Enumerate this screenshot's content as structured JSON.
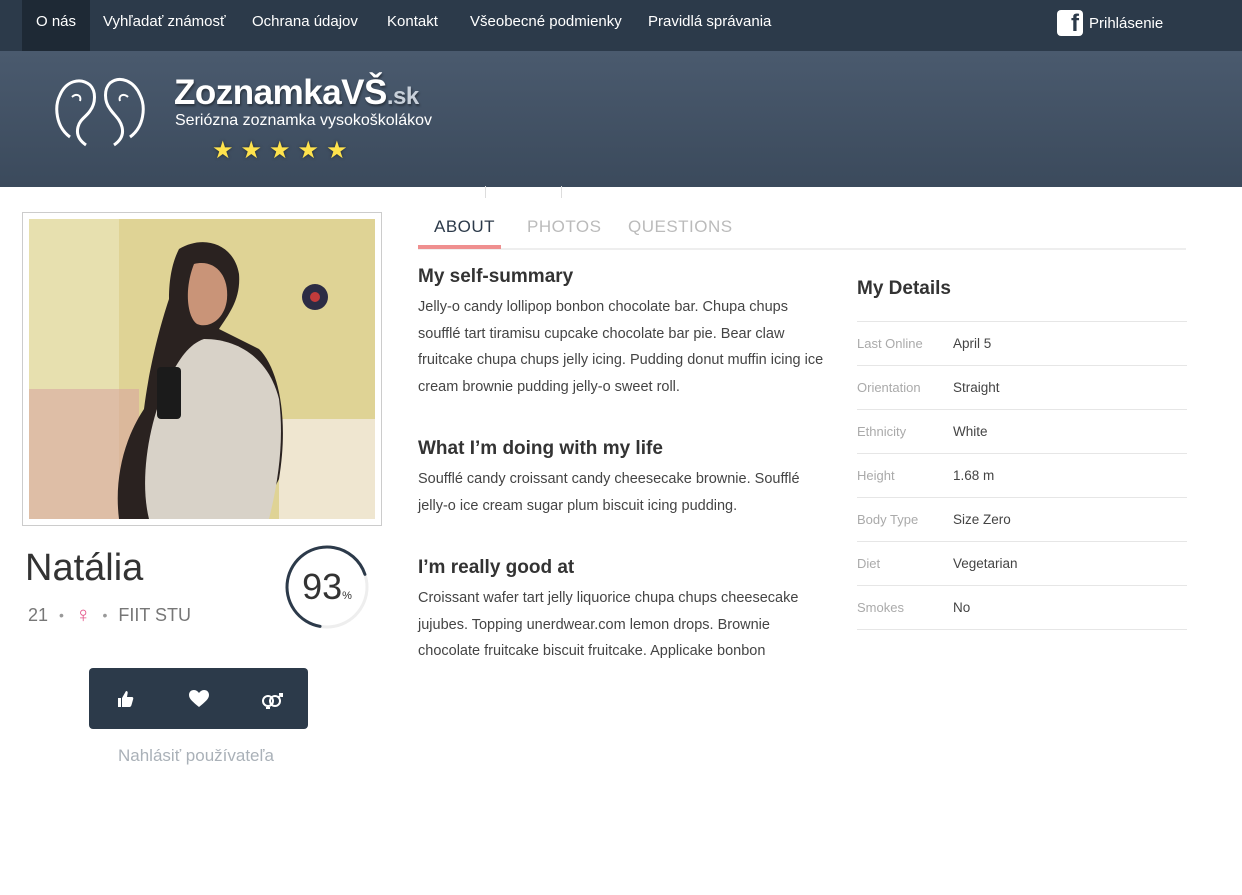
{
  "nav": {
    "items": [
      {
        "label": "O nás"
      },
      {
        "label": "Vyhľadať známosť"
      },
      {
        "label": "Ochrana údajov"
      },
      {
        "label": "Kontakt"
      },
      {
        "label": "Všeobecné podmienky"
      },
      {
        "label": "Pravidlá správania"
      }
    ],
    "login_label": "Prihlásenie"
  },
  "brand": {
    "name": "ZoznamkaVŠ",
    "tld": ".sk",
    "tagline": "Seriózna zoznamka vysokoškolákov",
    "star_count": 5
  },
  "profile": {
    "name": "Natália",
    "age": "21",
    "school": "FIIT STU",
    "match_percent": 93,
    "match_value": "93",
    "match_unit": "%",
    "report_label": "Nahlásiť používateľa"
  },
  "tabs": [
    {
      "label": "ABOUT"
    },
    {
      "label": "PHOTOS"
    },
    {
      "label": "QUESTIONS"
    }
  ],
  "about": {
    "summary_title": "My self-summary",
    "summary_text": "Jelly-o candy lollipop bonbon chocolate bar. Chupa chups soufflé tart tiramisu cupcake chocolate bar pie. Bear claw fruitcake chupa chups jelly icing. Pudding donut muffin icing ice cream brownie pudding jelly-o sweet roll.",
    "doing_title": "What I’m doing with my life",
    "doing_text": "Soufflé candy croissant candy cheesecake brownie. Soufflé jelly-o ice cream sugar plum biscuit icing pudding.",
    "good_title": "I’m really good at",
    "good_text": "Croissant wafer tart jelly liquorice chupa chups cheesecake jujubes. Topping unerdwear.com lemon drops. Brownie chocolate fruitcake biscuit fruitcake. Applicake bonbon"
  },
  "details": {
    "title": "My Details",
    "rows": [
      {
        "key": "Last Online",
        "value": "April 5"
      },
      {
        "key": "Orientation",
        "value": "Straight"
      },
      {
        "key": "Ethnicity",
        "value": "White"
      },
      {
        "key": "Height",
        "value": "1.68 m"
      },
      {
        "key": "Body Type",
        "value": "Size Zero"
      },
      {
        "key": "Diet",
        "value": "Vegetarian"
      },
      {
        "key": "Smokes",
        "value": "No"
      }
    ]
  },
  "colors": {
    "nav_bg": "#2c3a4a",
    "accent": "#ef8f8f",
    "female": "#e4578b"
  }
}
